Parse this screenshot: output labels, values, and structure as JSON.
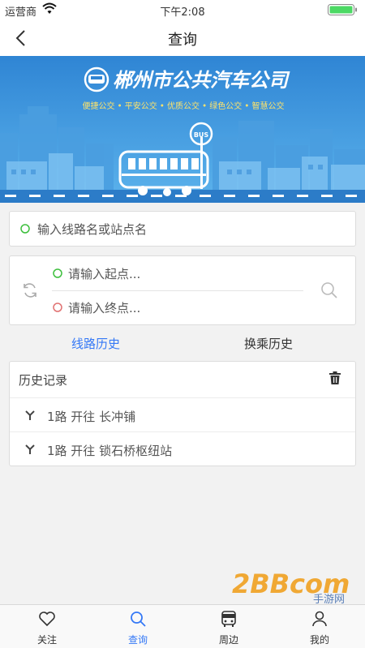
{
  "status_bar": {
    "carrier": "运营商",
    "time": "下午2:08"
  },
  "nav": {
    "title": "查询"
  },
  "banner": {
    "company_name": "郴州市公共汽车公司",
    "slogan": "便捷公交 • 平安公交 • 优质公交 • 绿色公交 • 智慧公交",
    "bus_sign": "BUS",
    "sky_color": "#3a8fd8"
  },
  "search": {
    "placeholder": "输入线路名或站点名"
  },
  "route": {
    "start_placeholder": "请输入起点...",
    "end_placeholder": "请输入终点..."
  },
  "tabs": [
    {
      "label": "线路历史",
      "active": true
    },
    {
      "label": "换乘历史",
      "active": false
    }
  ],
  "history": {
    "title": "历史记录",
    "items": [
      {
        "text": "1路  开往  长冲铺"
      },
      {
        "text": "1路  开往  锁石桥枢纽站"
      }
    ]
  },
  "tab_bar": [
    {
      "label": "关注",
      "icon": "heart-icon"
    },
    {
      "label": "查询",
      "icon": "search-icon",
      "active": true
    },
    {
      "label": "周边",
      "icon": "bus-icon"
    },
    {
      "label": "我的",
      "icon": "user-icon"
    }
  ],
  "watermark": {
    "text": "2BBcom",
    "sub": "手游网"
  },
  "colors": {
    "accent": "#3478f6",
    "green_dot": "#3cbf3c",
    "red_dot": "#e07070",
    "battery": "#4cd964"
  }
}
